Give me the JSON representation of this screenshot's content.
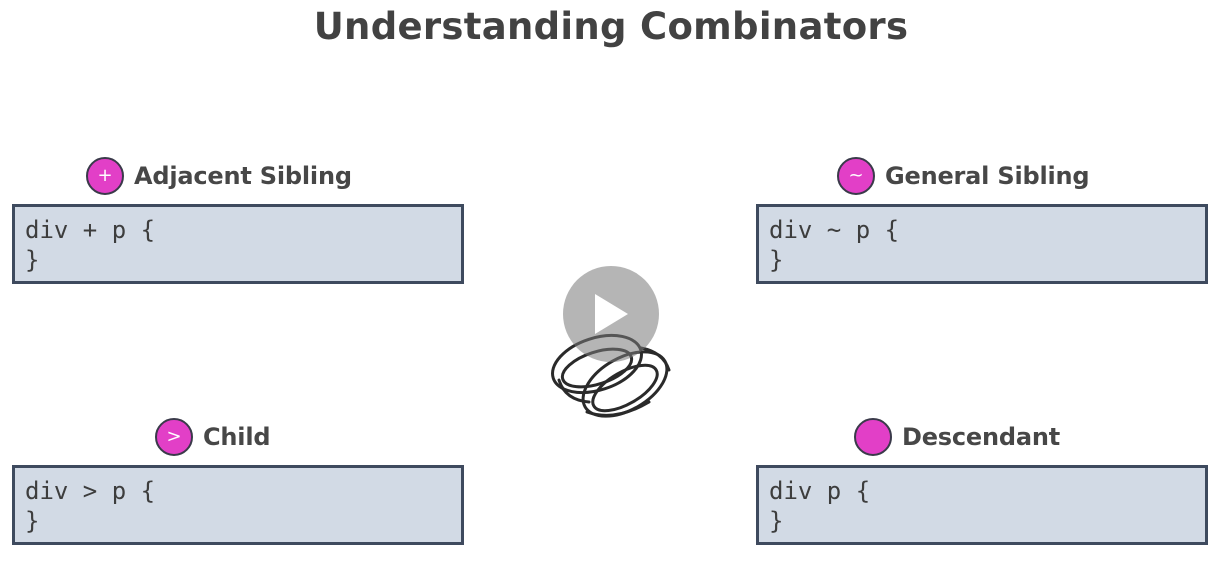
{
  "title": "Understanding Combinators",
  "combinators": {
    "adjacent": {
      "symbol": "+",
      "label": "Adjacent Sibling",
      "code_line1": "div + p {",
      "code_line2": "}"
    },
    "general": {
      "symbol": "~",
      "label": "General Sibling",
      "code_line1": "div ~ p {",
      "code_line2": "}"
    },
    "child": {
      "symbol": ">",
      "label": "Child",
      "code_line1": "div > p {",
      "code_line2": "}"
    },
    "descendant": {
      "symbol": "",
      "label": "Descendant",
      "code_line1": "div p {",
      "code_line2": "}"
    }
  },
  "icons": {
    "play": "play-icon",
    "rings": "linked-rings-icon"
  },
  "colors": {
    "badge": "#e23fc7",
    "code_bg": "#d2dae5",
    "code_border": "#3e4a5e"
  }
}
